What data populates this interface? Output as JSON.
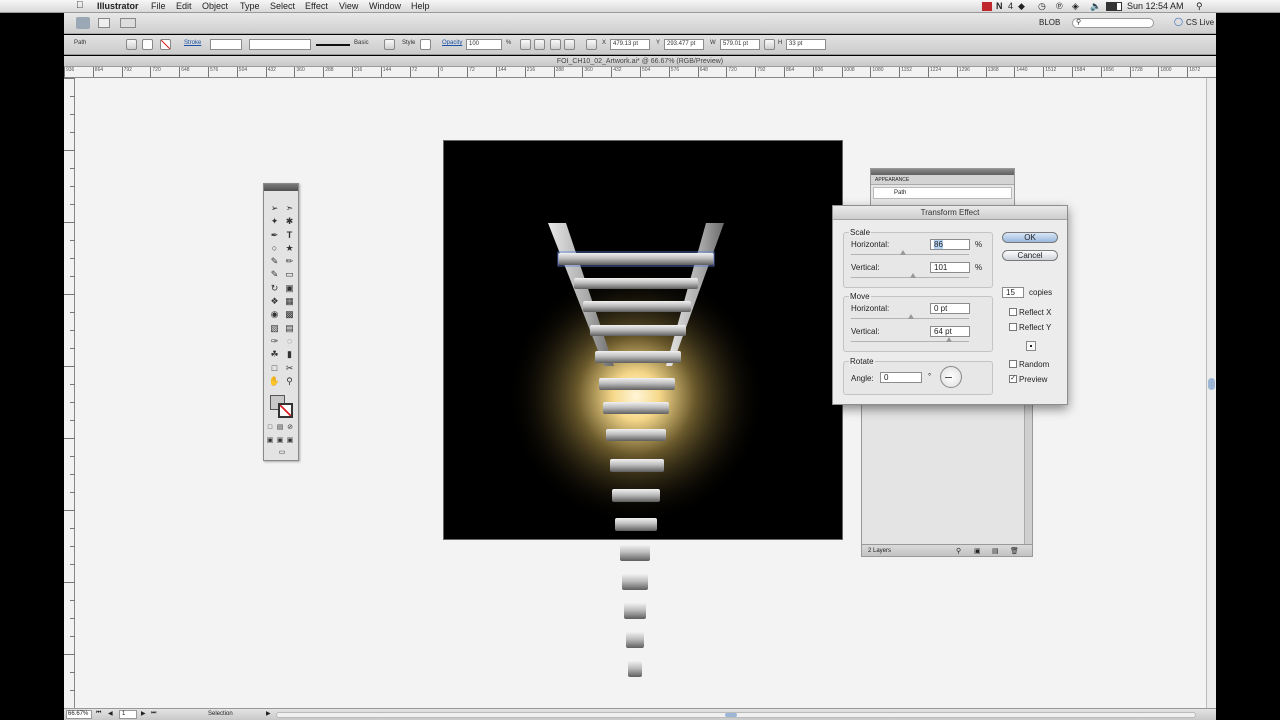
{
  "menubar": {
    "app_name": "Illustrator",
    "items": [
      "File",
      "Edit",
      "Object",
      "Type",
      "Select",
      "Effect",
      "View",
      "Window",
      "Help"
    ],
    "battery_text": "4",
    "clock": "Sun 12:54 AM"
  },
  "appbar": {
    "workspace": "BLOB",
    "cs_live": "CS Live"
  },
  "controlbar": {
    "selection_type": "Path",
    "stroke_label": "Stroke",
    "brush_label": "Basic",
    "style_label": "Style",
    "opacity_label": "Opacity",
    "opacity_value": "100",
    "opacity_unit": "%",
    "x_label": "X",
    "x_value": "479.13 pt",
    "y_label": "Y",
    "y_value": "293.477 pt",
    "w_label": "W",
    "w_value": "579.01 pt",
    "h_label": "H",
    "h_value": "33 pt"
  },
  "document": {
    "title": "FOI_CH10_02_Artwork.ai* @ 66.67% (RGB/Preview)"
  },
  "ruler_top": {
    "ticks": [
      "936",
      "864",
      "792",
      "720",
      "648",
      "576",
      "504",
      "432",
      "360",
      "288",
      "216",
      "144",
      "72",
      "0",
      "72",
      "144",
      "216",
      "288",
      "360",
      "432",
      "504",
      "576",
      "648",
      "720",
      "792",
      "864",
      "936",
      "1008",
      "1080",
      "1152",
      "1224",
      "1296",
      "1368",
      "1440",
      "1512",
      "1584",
      "1656",
      "1728",
      "1800",
      "1872"
    ]
  },
  "statusbar": {
    "zoom": "66.67%",
    "page": "1",
    "tool": "Selection"
  },
  "appearance_panel": {
    "title": "APPEARANCE",
    "row1": "Path"
  },
  "layers_panel": {
    "count": "2 Layers"
  },
  "dialog": {
    "title": "Transform Effect",
    "scale_label": "Scale",
    "scale_h_label": "Horizontal:",
    "scale_h_value": "86",
    "scale_v_label": "Vertical:",
    "scale_v_value": "101",
    "percent": "%",
    "move_label": "Move",
    "move_h_label": "Horizontal:",
    "move_h_value": "0 pt",
    "move_v_label": "Vertical:",
    "move_v_value": "64 pt",
    "rotate_label": "Rotate",
    "angle_label": "Angle:",
    "angle_value": "0",
    "degree": "°",
    "ok": "OK",
    "cancel": "Cancel",
    "copies_value": "15",
    "copies_label": "copies",
    "reflect_x": "Reflect X",
    "reflect_y": "Reflect Y",
    "random": "Random",
    "preview": "Preview",
    "preview_checked": true
  },
  "colors": {
    "glow": "#f6d88a",
    "rung_light": "#cfcfcf",
    "rung_dark": "#6e6e6e",
    "selection_blue": "#5a7fd6"
  }
}
